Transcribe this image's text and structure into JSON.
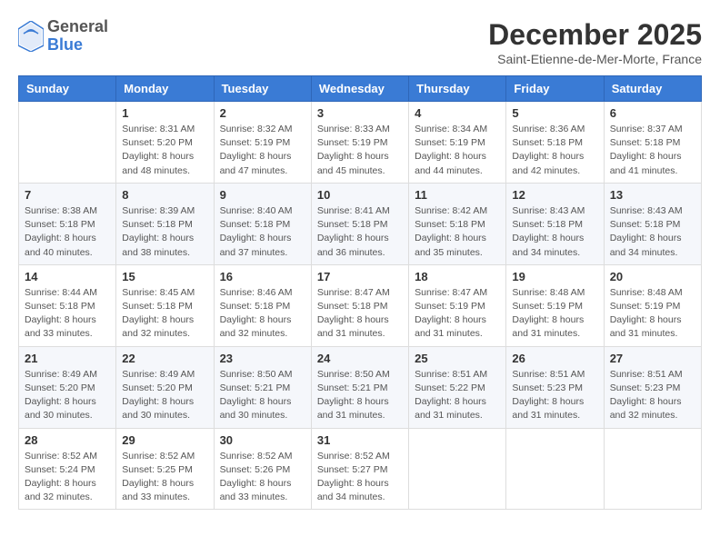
{
  "header": {
    "logo_line1": "General",
    "logo_line2": "Blue",
    "month_title": "December 2025",
    "subtitle": "Saint-Etienne-de-Mer-Morte, France"
  },
  "days_of_week": [
    "Sunday",
    "Monday",
    "Tuesday",
    "Wednesday",
    "Thursday",
    "Friday",
    "Saturday"
  ],
  "weeks": [
    [
      {
        "day": "",
        "info": ""
      },
      {
        "day": "1",
        "info": "Sunrise: 8:31 AM\nSunset: 5:20 PM\nDaylight: 8 hours\nand 48 minutes."
      },
      {
        "day": "2",
        "info": "Sunrise: 8:32 AM\nSunset: 5:19 PM\nDaylight: 8 hours\nand 47 minutes."
      },
      {
        "day": "3",
        "info": "Sunrise: 8:33 AM\nSunset: 5:19 PM\nDaylight: 8 hours\nand 45 minutes."
      },
      {
        "day": "4",
        "info": "Sunrise: 8:34 AM\nSunset: 5:19 PM\nDaylight: 8 hours\nand 44 minutes."
      },
      {
        "day": "5",
        "info": "Sunrise: 8:36 AM\nSunset: 5:18 PM\nDaylight: 8 hours\nand 42 minutes."
      },
      {
        "day": "6",
        "info": "Sunrise: 8:37 AM\nSunset: 5:18 PM\nDaylight: 8 hours\nand 41 minutes."
      }
    ],
    [
      {
        "day": "7",
        "info": "Sunrise: 8:38 AM\nSunset: 5:18 PM\nDaylight: 8 hours\nand 40 minutes."
      },
      {
        "day": "8",
        "info": "Sunrise: 8:39 AM\nSunset: 5:18 PM\nDaylight: 8 hours\nand 38 minutes."
      },
      {
        "day": "9",
        "info": "Sunrise: 8:40 AM\nSunset: 5:18 PM\nDaylight: 8 hours\nand 37 minutes."
      },
      {
        "day": "10",
        "info": "Sunrise: 8:41 AM\nSunset: 5:18 PM\nDaylight: 8 hours\nand 36 minutes."
      },
      {
        "day": "11",
        "info": "Sunrise: 8:42 AM\nSunset: 5:18 PM\nDaylight: 8 hours\nand 35 minutes."
      },
      {
        "day": "12",
        "info": "Sunrise: 8:43 AM\nSunset: 5:18 PM\nDaylight: 8 hours\nand 34 minutes."
      },
      {
        "day": "13",
        "info": "Sunrise: 8:43 AM\nSunset: 5:18 PM\nDaylight: 8 hours\nand 34 minutes."
      }
    ],
    [
      {
        "day": "14",
        "info": "Sunrise: 8:44 AM\nSunset: 5:18 PM\nDaylight: 8 hours\nand 33 minutes."
      },
      {
        "day": "15",
        "info": "Sunrise: 8:45 AM\nSunset: 5:18 PM\nDaylight: 8 hours\nand 32 minutes."
      },
      {
        "day": "16",
        "info": "Sunrise: 8:46 AM\nSunset: 5:18 PM\nDaylight: 8 hours\nand 32 minutes."
      },
      {
        "day": "17",
        "info": "Sunrise: 8:47 AM\nSunset: 5:18 PM\nDaylight: 8 hours\nand 31 minutes."
      },
      {
        "day": "18",
        "info": "Sunrise: 8:47 AM\nSunset: 5:19 PM\nDaylight: 8 hours\nand 31 minutes."
      },
      {
        "day": "19",
        "info": "Sunrise: 8:48 AM\nSunset: 5:19 PM\nDaylight: 8 hours\nand 31 minutes."
      },
      {
        "day": "20",
        "info": "Sunrise: 8:48 AM\nSunset: 5:19 PM\nDaylight: 8 hours\nand 31 minutes."
      }
    ],
    [
      {
        "day": "21",
        "info": "Sunrise: 8:49 AM\nSunset: 5:20 PM\nDaylight: 8 hours\nand 30 minutes."
      },
      {
        "day": "22",
        "info": "Sunrise: 8:49 AM\nSunset: 5:20 PM\nDaylight: 8 hours\nand 30 minutes."
      },
      {
        "day": "23",
        "info": "Sunrise: 8:50 AM\nSunset: 5:21 PM\nDaylight: 8 hours\nand 30 minutes."
      },
      {
        "day": "24",
        "info": "Sunrise: 8:50 AM\nSunset: 5:21 PM\nDaylight: 8 hours\nand 31 minutes."
      },
      {
        "day": "25",
        "info": "Sunrise: 8:51 AM\nSunset: 5:22 PM\nDaylight: 8 hours\nand 31 minutes."
      },
      {
        "day": "26",
        "info": "Sunrise: 8:51 AM\nSunset: 5:23 PM\nDaylight: 8 hours\nand 31 minutes."
      },
      {
        "day": "27",
        "info": "Sunrise: 8:51 AM\nSunset: 5:23 PM\nDaylight: 8 hours\nand 32 minutes."
      }
    ],
    [
      {
        "day": "28",
        "info": "Sunrise: 8:52 AM\nSunset: 5:24 PM\nDaylight: 8 hours\nand 32 minutes."
      },
      {
        "day": "29",
        "info": "Sunrise: 8:52 AM\nSunset: 5:25 PM\nDaylight: 8 hours\nand 33 minutes."
      },
      {
        "day": "30",
        "info": "Sunrise: 8:52 AM\nSunset: 5:26 PM\nDaylight: 8 hours\nand 33 minutes."
      },
      {
        "day": "31",
        "info": "Sunrise: 8:52 AM\nSunset: 5:27 PM\nDaylight: 8 hours\nand 34 minutes."
      },
      {
        "day": "",
        "info": ""
      },
      {
        "day": "",
        "info": ""
      },
      {
        "day": "",
        "info": ""
      }
    ]
  ]
}
